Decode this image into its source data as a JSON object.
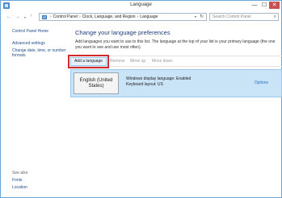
{
  "window": {
    "title": "Language",
    "close_glyph": "✕",
    "min_glyph": "—",
    "max_glyph": "☐"
  },
  "nav": {
    "back_glyph": "←",
    "forward_glyph": "→",
    "recent_glyph": "▾",
    "up_glyph": "↑",
    "breadcrumb": [
      "Control Panel",
      "Clock, Language, and Region",
      "Language"
    ],
    "sep_glyph": "›",
    "search_placeholder": "Search Control Panel",
    "search_glyph": "⌕",
    "refresh_glyph": "↻",
    "dropdown_glyph": "▾"
  },
  "sidebar": {
    "home": "Control Panel Home",
    "advanced": "Advanced settings",
    "date": "Change date, time, or number formats",
    "see_also": "See also",
    "fonts": "Fonts",
    "location": "Location"
  },
  "main": {
    "title": "Change your language preferences",
    "description": "Add languages you want to use to this list. The language at the top of your list is your primary language (the one you want to see and use most often).",
    "toolbar": {
      "add": "Add a language",
      "remove": "Remove",
      "move_up": "Move up",
      "move_down": "Move down"
    },
    "languages": [
      {
        "name": "English (United States)",
        "info_line1": "Windows display language: Enabled",
        "info_line2": "Keyboard layout: US",
        "options": "Options"
      }
    ]
  },
  "colors": {
    "accent": "#1e3e80",
    "link": "#1f4e8c",
    "highlight": "#d22a2a",
    "selected_row": "#c9e3f7"
  }
}
